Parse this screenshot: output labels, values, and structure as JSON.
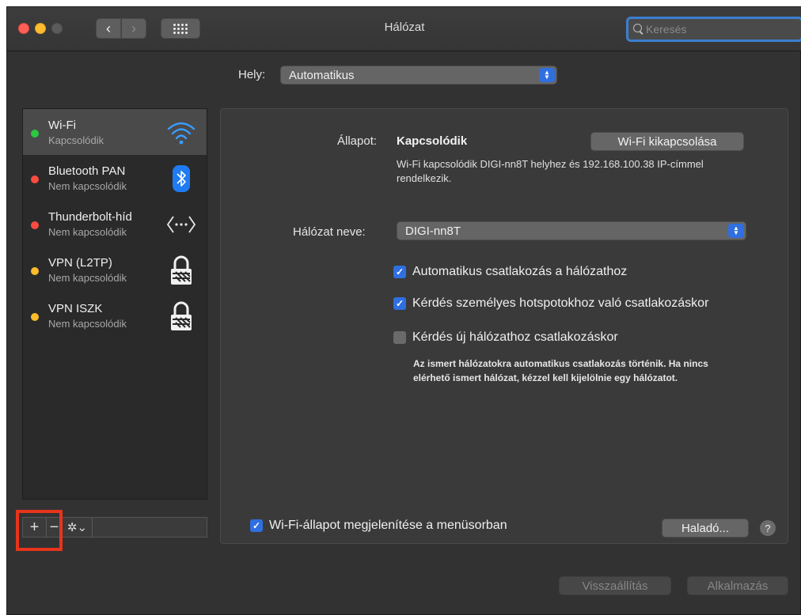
{
  "window": {
    "title": "Hálózat",
    "search_placeholder": "Keresés",
    "search_icon": "search-icon",
    "back_icon": "chevron-left-icon",
    "forward_icon": "chevron-right-icon",
    "show_all_icon": "grid-icon"
  },
  "location": {
    "label": "Hely:",
    "value": "Automatikus"
  },
  "sidebar": {
    "services": [
      {
        "name": "Wi-Fi",
        "status": "Kapcsolódik",
        "status_color": "#2bc840",
        "icon": "wifi-icon",
        "selected": true
      },
      {
        "name": "Bluetooth PAN",
        "status": "Nem kapcsolódik",
        "status_color": "#fe4b40",
        "icon": "bluetooth-icon",
        "selected": false
      },
      {
        "name": "Thunderbolt-híd",
        "status": "Nem kapcsolódik",
        "status_color": "#fe4b40",
        "icon": "thunderbolt-bridge-icon",
        "selected": false
      },
      {
        "name": "VPN (L2TP)",
        "status": "Nem kapcsolódik",
        "status_color": "#fdbc2b",
        "icon": "vpn-lock-icon",
        "selected": false
      },
      {
        "name": "VPN ISZK",
        "status": "Nem kapcsolódik",
        "status_color": "#fdbc2b",
        "icon": "vpn-lock-icon",
        "selected": false
      }
    ],
    "toolbar": {
      "add": "+",
      "remove": "−",
      "action_icon": "gear-icon"
    }
  },
  "panel": {
    "status_label": "Állapot:",
    "status_value": "Kapcsolódik",
    "wifi_off_button": "Wi-Fi kikapcsolása",
    "status_description": "Wi-Fi kapcsolódik DIGI-nn8T helyhez és 192.168.100.38 IP-címmel rendelkezik.",
    "network_name_label": "Hálózat neve:",
    "network_name": "DIGI-nn8T",
    "checkboxes": [
      {
        "label": "Automatikus csatlakozás a hálózathoz",
        "checked": true
      },
      {
        "label": "Kérdés személyes hotspotokhoz való csatlakozáskor",
        "checked": true
      },
      {
        "label": "Kérdés új hálózathoz csatlakozáskor",
        "checked": false
      }
    ],
    "known_networks_note": "Az ismert hálózatokra automatikus csatlakozás történik. Ha nincs elérhető ismert hálózat, kézzel kell kijelölnie egy hálózatot.",
    "show_status_in_menubar": {
      "label": "Wi-Fi-állapot megjelenítése a menüsorban",
      "checked": true
    },
    "advanced_button": "Haladó...",
    "help_button": "?"
  },
  "footer": {
    "revert_button": "Visszaállítás",
    "apply_button": "Alkalmazás"
  },
  "colors": {
    "accent": "#2f6fe0",
    "highlight_annotation": "#e8341c"
  }
}
